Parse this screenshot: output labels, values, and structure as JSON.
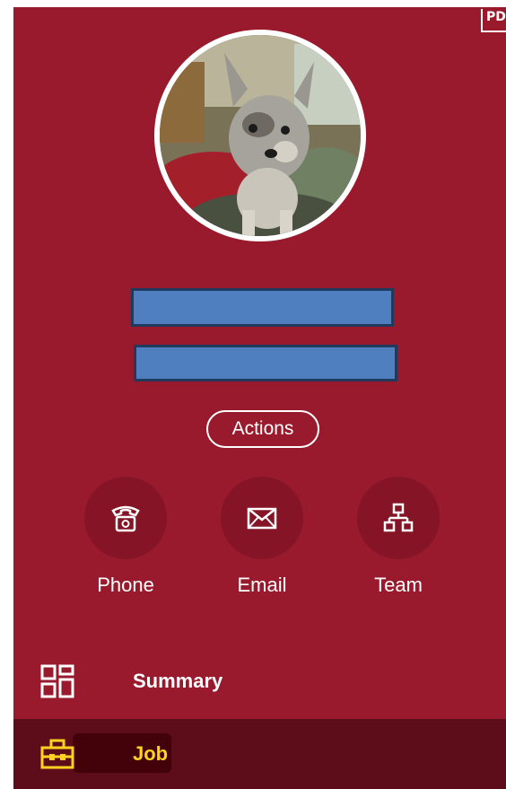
{
  "header": {
    "pdf_label": "PDF"
  },
  "profile": {
    "avatar_alt": "dog-photo"
  },
  "actions_button": {
    "label": "Actions"
  },
  "quick_actions": [
    {
      "label": "Phone",
      "icon": "phone-icon"
    },
    {
      "label": "Email",
      "icon": "email-icon"
    },
    {
      "label": "Team",
      "icon": "team-icon"
    }
  ],
  "nav": {
    "summary": {
      "label": "Summary",
      "icon": "summary-grid-icon"
    },
    "job": {
      "label": "Job",
      "icon": "briefcase-icon"
    }
  },
  "colors": {
    "panel_bg": "#981a2c",
    "circle_bg": "#851526",
    "selected_bg": "#5c0d19",
    "selected_text": "#ffd21f",
    "redaction": "#4f7fbf"
  }
}
